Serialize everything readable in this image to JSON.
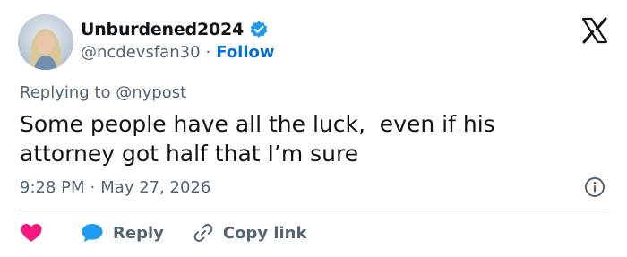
{
  "author": {
    "display_name": "Unburdened2024",
    "handle": "@ncdevsfan30",
    "separator": "·",
    "follow_label": "Follow",
    "verified": true
  },
  "reply_context": {
    "prefix": "Replying to",
    "handle": "@nypost"
  },
  "tweet": {
    "text": "Some people have all the luck,  even if his attorney got half that I’m sure",
    "time": "9:28 PM",
    "separator": "·",
    "date": "May 27, 2026"
  },
  "actions": {
    "like_icon": "heart-icon",
    "reply_label": "Reply",
    "reply_icon": "speech-bubble-icon",
    "copy_label": "Copy link",
    "copy_icon": "link-icon"
  },
  "colors": {
    "verified_badge": "#1d9bf0",
    "link_blue": "#006fd6",
    "like_red": "#f91880",
    "reply_blue": "#1d9bf0",
    "secondary_text": "#536471",
    "primary_text": "#0f1419",
    "divider": "#cfd9de"
  },
  "brand_icon": "x-logo-icon",
  "info_icon": "info-icon"
}
